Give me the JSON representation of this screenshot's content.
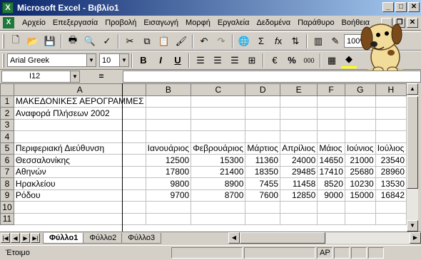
{
  "window": {
    "title": "Microsoft Excel - Βιβλίο1",
    "app_icon": "X"
  },
  "menu": {
    "items": [
      "Αρχείο",
      "Επεξεργασία",
      "Προβολή",
      "Εισαγωγή",
      "Μορφή",
      "Εργαλεία",
      "Δεδομένα",
      "Παράθυρο",
      "Βοήθεια"
    ]
  },
  "toolbar": {
    "zoom": "100%",
    "font_name": "Arial Greek",
    "font_size": "10"
  },
  "formula_bar": {
    "name_box": "I12",
    "equals": "=",
    "formula": ""
  },
  "grid": {
    "columns": [
      "A",
      "B",
      "C",
      "D",
      "E",
      "F",
      "G",
      "H"
    ],
    "rows": [
      {
        "n": "1",
        "cells": [
          "ΜΑΚΕΔΟΝΙΚΕΣ ΑΕΡΟΓΡΑΜΜΕΣ",
          "",
          "",
          "",
          "",
          "",
          "",
          ""
        ]
      },
      {
        "n": "2",
        "cells": [
          "Αναφορά Πλήσεων 2002",
          "",
          "",
          "",
          "",
          "",
          "",
          ""
        ]
      },
      {
        "n": "3",
        "cells": [
          "",
          "",
          "",
          "",
          "",
          "",
          "",
          ""
        ]
      },
      {
        "n": "4",
        "cells": [
          "",
          "",
          "",
          "",
          "",
          "",
          "",
          ""
        ]
      },
      {
        "n": "5",
        "cells": [
          "Περιφεριακή Διεύθυνση",
          "Ιανουάριος",
          "Φεβρουάριος",
          "Μάρτιος",
          "Απρίλιος",
          "Μάιος",
          "Ιούνιος",
          "Ιούλιος"
        ]
      },
      {
        "n": "6",
        "cells": [
          "Θεσσαλονίκης",
          "12500",
          "15300",
          "11360",
          "24000",
          "14650",
          "21000",
          "23540"
        ]
      },
      {
        "n": "7",
        "cells": [
          "Αθηνών",
          "17800",
          "21400",
          "18350",
          "29485",
          "17410",
          "25680",
          "28960"
        ]
      },
      {
        "n": "8",
        "cells": [
          "Ηρακλείου",
          "9800",
          "8900",
          "7455",
          "11458",
          "8520",
          "10230",
          "13530"
        ]
      },
      {
        "n": "9",
        "cells": [
          "Ρόδου",
          "9700",
          "8700",
          "7600",
          "12850",
          "9000",
          "15000",
          "16842"
        ]
      },
      {
        "n": "10",
        "cells": [
          "",
          "",
          "",
          "",
          "",
          "",
          "",
          ""
        ]
      },
      {
        "n": "11",
        "cells": [
          "",
          "",
          "",
          "",
          "",
          "",
          "",
          ""
        ]
      }
    ]
  },
  "sheets": [
    "Φύλλο1",
    "Φύλλο2",
    "Φύλλο3"
  ],
  "status": {
    "text": "Έτοιμο",
    "indicator": "AP"
  }
}
